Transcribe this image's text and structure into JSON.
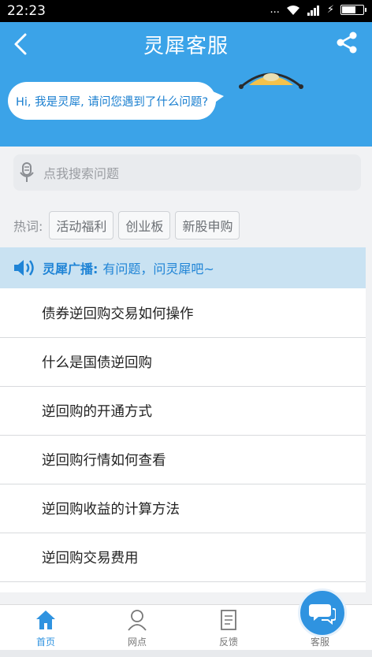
{
  "status_bar": {
    "time": "22:23",
    "signal_dots": "...",
    "charging_symbol": "⚡"
  },
  "header": {
    "title": "灵犀客服",
    "bubble_text": "Hi, 我是灵犀, 请问您遇到了什么问题?",
    "back_icon": "chevron-left-icon",
    "share_icon": "share-icon",
    "background": "#3ba3e8"
  },
  "search": {
    "placeholder": "点我搜索问题",
    "icon": "microphone-icon"
  },
  "hot": {
    "label": "热词:",
    "tags": [
      "活动福利",
      "创业板",
      "新股申购"
    ]
  },
  "broadcast": {
    "label": "灵犀广播:",
    "text": "有问题，问灵犀吧~",
    "icon": "speaker-icon",
    "color": "#1f84d6"
  },
  "questions": [
    "债券逆回购交易如何操作",
    "什么是国债逆回购",
    "逆回购的开通方式",
    "逆回购行情如何查看",
    "逆回购收益的计算方法",
    "逆回购交易费用"
  ],
  "tabbar": {
    "tabs": [
      {
        "label": "首页",
        "icon": "home-icon"
      },
      {
        "label": "网点",
        "icon": "person-icon"
      },
      {
        "label": "反馈",
        "icon": "document-icon"
      },
      {
        "label": "客服",
        "icon": "chat-icon"
      }
    ],
    "accent": "#2f93e0"
  }
}
